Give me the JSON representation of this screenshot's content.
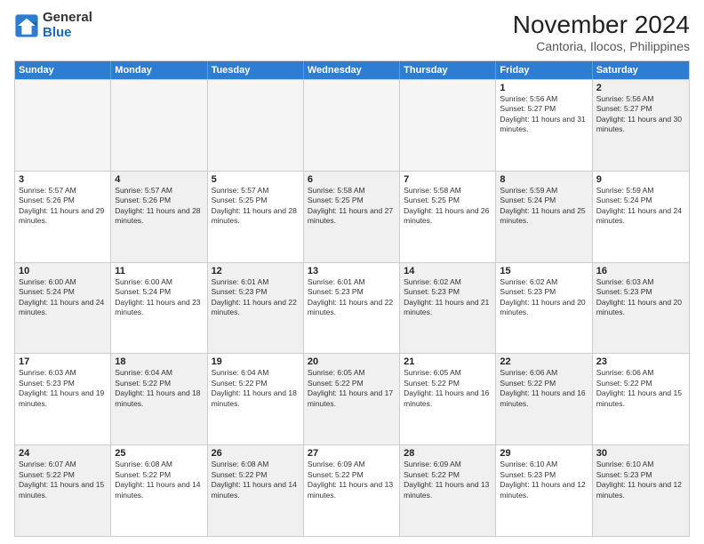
{
  "logo": {
    "general": "General",
    "blue": "Blue"
  },
  "title": "November 2024",
  "location": "Cantoria, Ilocos, Philippines",
  "weekdays": [
    "Sunday",
    "Monday",
    "Tuesday",
    "Wednesday",
    "Thursday",
    "Friday",
    "Saturday"
  ],
  "rows": [
    [
      {
        "day": "",
        "empty": true
      },
      {
        "day": "",
        "empty": true
      },
      {
        "day": "",
        "empty": true
      },
      {
        "day": "",
        "empty": true
      },
      {
        "day": "",
        "empty": true
      },
      {
        "day": "1",
        "sunrise": "5:56 AM",
        "sunset": "5:27 PM",
        "daylight": "11 hours and 31 minutes."
      },
      {
        "day": "2",
        "sunrise": "5:56 AM",
        "sunset": "5:27 PM",
        "daylight": "11 hours and 30 minutes.",
        "shaded": true
      }
    ],
    [
      {
        "day": "3",
        "sunrise": "5:57 AM",
        "sunset": "5:26 PM",
        "daylight": "11 hours and 29 minutes."
      },
      {
        "day": "4",
        "sunrise": "5:57 AM",
        "sunset": "5:26 PM",
        "daylight": "11 hours and 28 minutes.",
        "shaded": true
      },
      {
        "day": "5",
        "sunrise": "5:57 AM",
        "sunset": "5:25 PM",
        "daylight": "11 hours and 28 minutes."
      },
      {
        "day": "6",
        "sunrise": "5:58 AM",
        "sunset": "5:25 PM",
        "daylight": "11 hours and 27 minutes.",
        "shaded": true
      },
      {
        "day": "7",
        "sunrise": "5:58 AM",
        "sunset": "5:25 PM",
        "daylight": "11 hours and 26 minutes."
      },
      {
        "day": "8",
        "sunrise": "5:59 AM",
        "sunset": "5:24 PM",
        "daylight": "11 hours and 25 minutes.",
        "shaded": true
      },
      {
        "day": "9",
        "sunrise": "5:59 AM",
        "sunset": "5:24 PM",
        "daylight": "11 hours and 24 minutes."
      }
    ],
    [
      {
        "day": "10",
        "sunrise": "6:00 AM",
        "sunset": "5:24 PM",
        "daylight": "11 hours and 24 minutes.",
        "shaded": true
      },
      {
        "day": "11",
        "sunrise": "6:00 AM",
        "sunset": "5:24 PM",
        "daylight": "11 hours and 23 minutes."
      },
      {
        "day": "12",
        "sunrise": "6:01 AM",
        "sunset": "5:23 PM",
        "daylight": "11 hours and 22 minutes.",
        "shaded": true
      },
      {
        "day": "13",
        "sunrise": "6:01 AM",
        "sunset": "5:23 PM",
        "daylight": "11 hours and 22 minutes."
      },
      {
        "day": "14",
        "sunrise": "6:02 AM",
        "sunset": "5:23 PM",
        "daylight": "11 hours and 21 minutes.",
        "shaded": true
      },
      {
        "day": "15",
        "sunrise": "6:02 AM",
        "sunset": "5:23 PM",
        "daylight": "11 hours and 20 minutes."
      },
      {
        "day": "16",
        "sunrise": "6:03 AM",
        "sunset": "5:23 PM",
        "daylight": "11 hours and 20 minutes.",
        "shaded": true
      }
    ],
    [
      {
        "day": "17",
        "sunrise": "6:03 AM",
        "sunset": "5:23 PM",
        "daylight": "11 hours and 19 minutes."
      },
      {
        "day": "18",
        "sunrise": "6:04 AM",
        "sunset": "5:22 PM",
        "daylight": "11 hours and 18 minutes.",
        "shaded": true
      },
      {
        "day": "19",
        "sunrise": "6:04 AM",
        "sunset": "5:22 PM",
        "daylight": "11 hours and 18 minutes."
      },
      {
        "day": "20",
        "sunrise": "6:05 AM",
        "sunset": "5:22 PM",
        "daylight": "11 hours and 17 minutes.",
        "shaded": true
      },
      {
        "day": "21",
        "sunrise": "6:05 AM",
        "sunset": "5:22 PM",
        "daylight": "11 hours and 16 minutes."
      },
      {
        "day": "22",
        "sunrise": "6:06 AM",
        "sunset": "5:22 PM",
        "daylight": "11 hours and 16 minutes.",
        "shaded": true
      },
      {
        "day": "23",
        "sunrise": "6:06 AM",
        "sunset": "5:22 PM",
        "daylight": "11 hours and 15 minutes."
      }
    ],
    [
      {
        "day": "24",
        "sunrise": "6:07 AM",
        "sunset": "5:22 PM",
        "daylight": "11 hours and 15 minutes.",
        "shaded": true
      },
      {
        "day": "25",
        "sunrise": "6:08 AM",
        "sunset": "5:22 PM",
        "daylight": "11 hours and 14 minutes."
      },
      {
        "day": "26",
        "sunrise": "6:08 AM",
        "sunset": "5:22 PM",
        "daylight": "11 hours and 14 minutes.",
        "shaded": true
      },
      {
        "day": "27",
        "sunrise": "6:09 AM",
        "sunset": "5:22 PM",
        "daylight": "11 hours and 13 minutes."
      },
      {
        "day": "28",
        "sunrise": "6:09 AM",
        "sunset": "5:22 PM",
        "daylight": "11 hours and 13 minutes.",
        "shaded": true
      },
      {
        "day": "29",
        "sunrise": "6:10 AM",
        "sunset": "5:23 PM",
        "daylight": "11 hours and 12 minutes."
      },
      {
        "day": "30",
        "sunrise": "6:10 AM",
        "sunset": "5:23 PM",
        "daylight": "11 hours and 12 minutes.",
        "shaded": true
      }
    ]
  ]
}
